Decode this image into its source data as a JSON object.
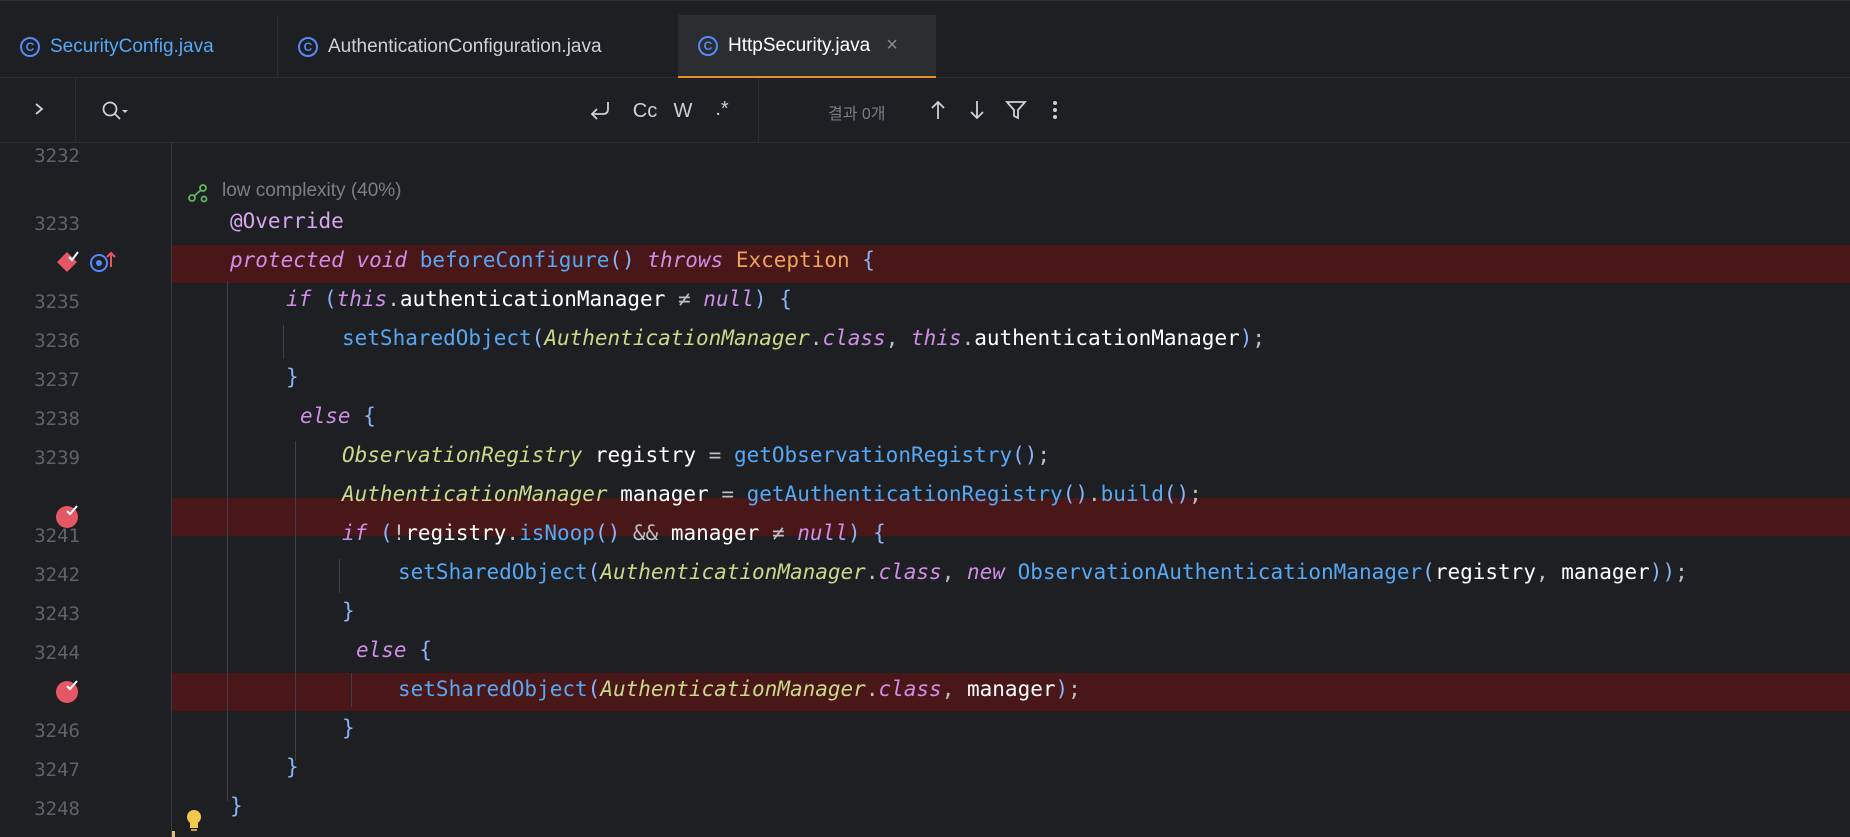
{
  "tabs": [
    {
      "label": "SecurityConfig.java",
      "icon": "class-icon",
      "active": false
    },
    {
      "label": "AuthenticationConfiguration.java",
      "icon": "class-icon",
      "active": false
    },
    {
      "label": "HttpSecurity.java",
      "icon": "class-icon",
      "active": true,
      "close": "×"
    }
  ],
  "find": {
    "match_case": "Cc",
    "words": "W",
    "regex": ".*",
    "results": "결과 0개"
  },
  "editor": {
    "inlay_hint": "low complexity (40%)",
    "line_numbers": [
      "3232",
      "3233",
      "3235",
      "3236",
      "3237",
      "3238",
      "3239",
      "3241",
      "3242",
      "3243",
      "3244",
      "3246",
      "3247",
      "3248"
    ],
    "colors": {
      "breakpoint": "#e55765",
      "highlight": "#4a1718",
      "accent": "#e5902b"
    }
  }
}
